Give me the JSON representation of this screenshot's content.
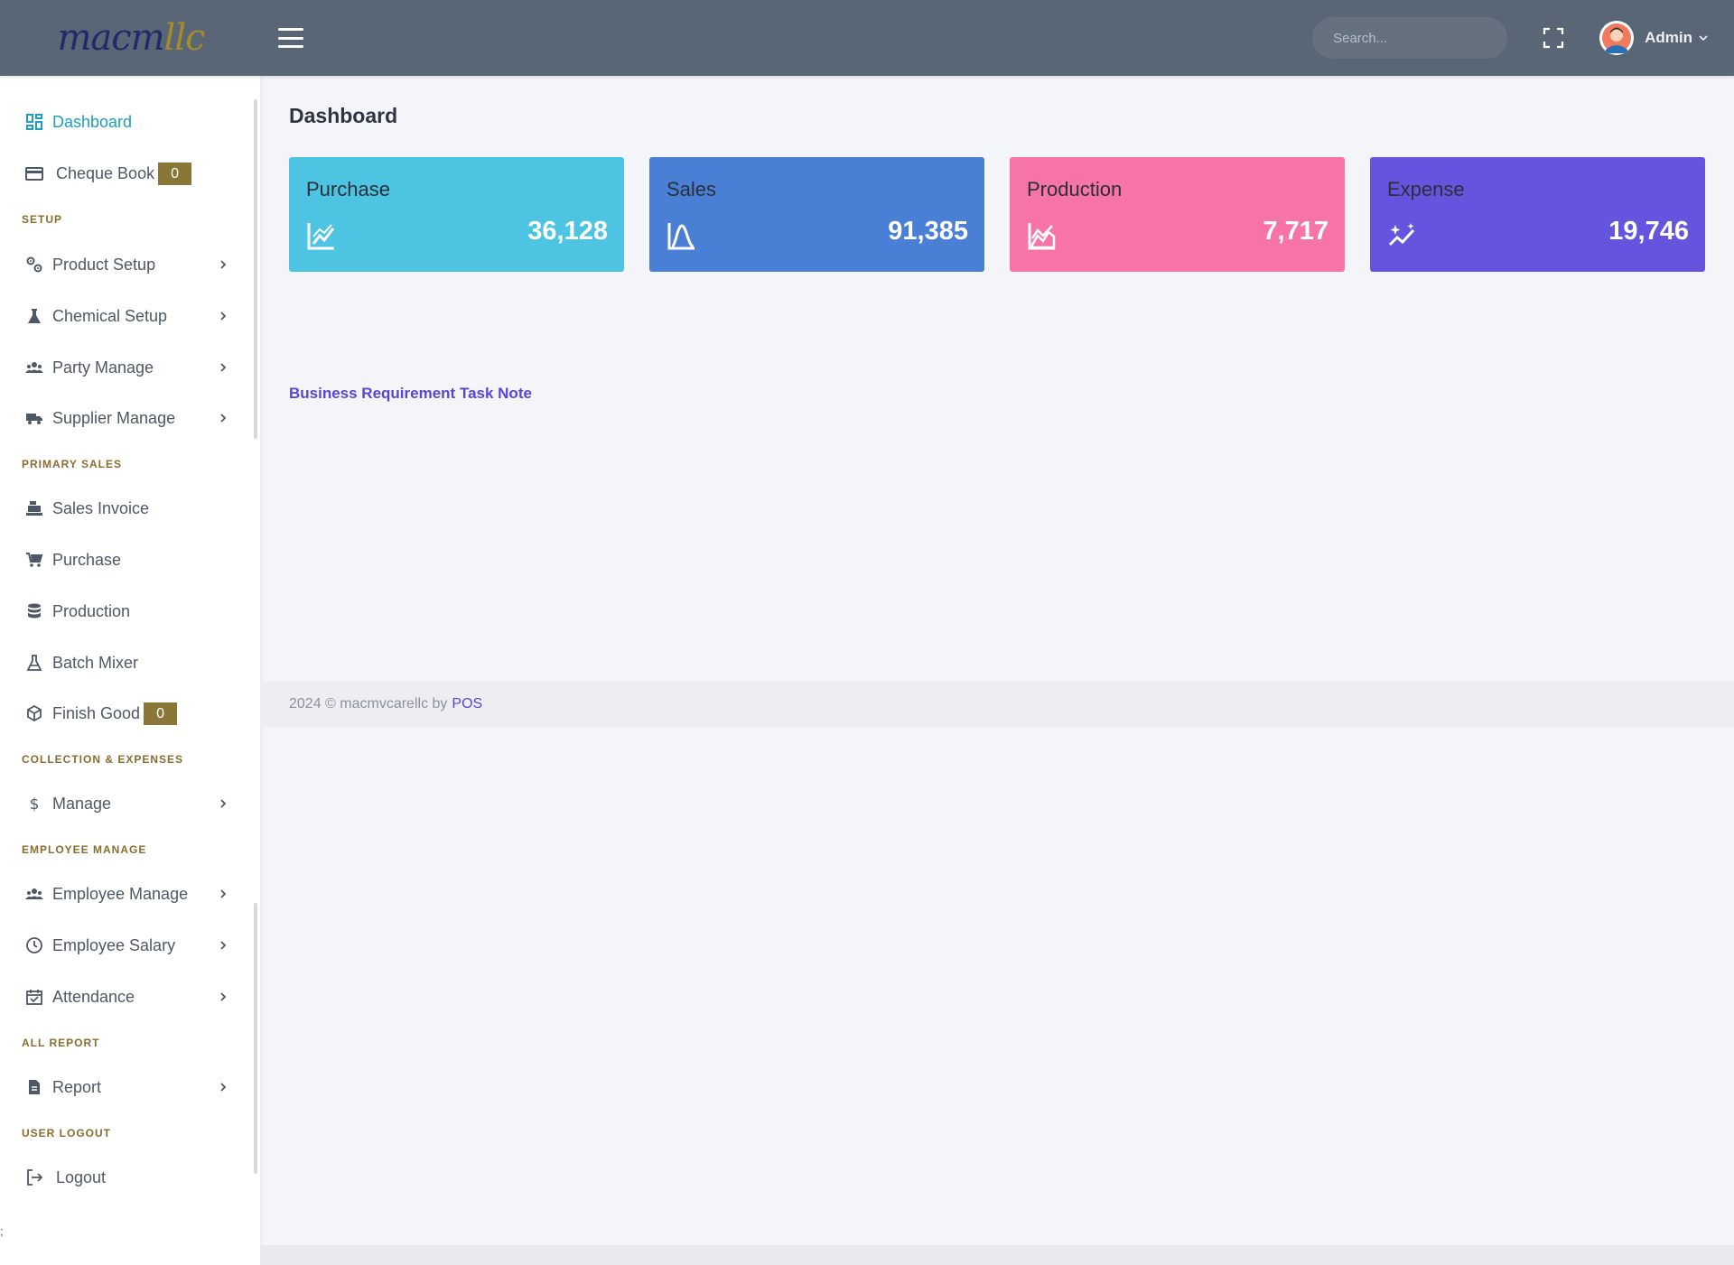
{
  "logo": {
    "part1": "macm",
    "part2": "llc"
  },
  "header": {
    "search_placeholder": "Search...",
    "user_name": "Admin"
  },
  "sidebar": {
    "items": {
      "dashboard": "Dashboard",
      "cheque_book": "Cheque Book",
      "cheque_book_badge": "0",
      "product_setup": "Product Setup",
      "chemical_setup": "Chemical Setup",
      "party_manage": "Party Manage",
      "supplier_manage": "Supplier Manage",
      "sales_invoice": "Sales Invoice",
      "purchase": "Purchase",
      "production": "Production",
      "batch_mixer": "Batch Mixer",
      "finish_good": "Finish Good",
      "finish_good_badge": "0",
      "manage": "Manage",
      "employee_manage": "Employee Manage",
      "employee_salary": "Employee Salary",
      "attendance": "Attendance",
      "report": "Report",
      "logout": "Logout"
    },
    "sections": {
      "setup": "SETUP",
      "primary_sales": "PRIMARY SALES",
      "collection": "COLLECTION & EXPENSES",
      "employee": "EMPLOYEE MANAGE",
      "all_report": "ALL REPORT",
      "user_logout": "USER LOGOUT"
    }
  },
  "main": {
    "title": "Dashboard",
    "cards": [
      {
        "label": "Purchase",
        "value": "36,128",
        "color": "#4dc4e2",
        "icon": "chart-line-icon"
      },
      {
        "label": "Sales",
        "value": "91,385",
        "color": "#4a7fd6",
        "icon": "bell-curve-icon"
      },
      {
        "label": "Production",
        "value": "7,717",
        "color": "#f674a8",
        "icon": "area-chart-icon"
      },
      {
        "label": "Expense",
        "value": "19,746",
        "color": "#6555de",
        "icon": "sparkle-trend-icon"
      }
    ],
    "note_link": "Business Requirement Task Note"
  },
  "footer": {
    "text": "2024 © macmvcarellc by",
    "link": "POS"
  },
  "stray_char": ";"
}
